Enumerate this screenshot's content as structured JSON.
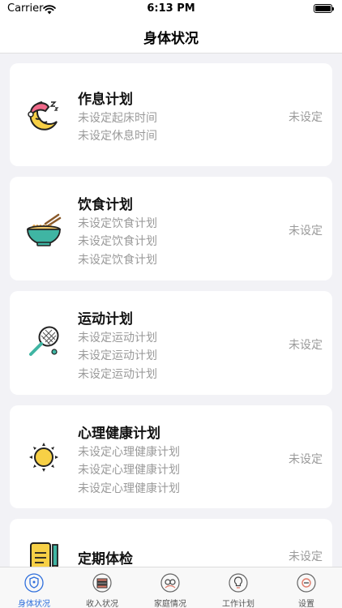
{
  "status_bar": {
    "carrier": "Carrier",
    "time": "6:13 PM"
  },
  "nav": {
    "title": "身体状况"
  },
  "colors": {
    "accent": "#2f6fdc",
    "background": "#f2f2f6",
    "card": "#ffffff",
    "muted_text": "#9a9a9a"
  },
  "cards": [
    {
      "icon": "sleeping-moon-icon",
      "title": "作息计划",
      "lines": [
        "未设定起床时间",
        "未设定休息时间"
      ],
      "status": "未设定"
    },
    {
      "icon": "noodle-bowl-icon",
      "title": "饮食计划",
      "lines": [
        "未设定饮食计划",
        "未设定饮食计划",
        "未设定饮食计划"
      ],
      "status": "未设定"
    },
    {
      "icon": "tennis-racket-icon",
      "title": "运动计划",
      "lines": [
        "未设定运动计划",
        "未设定运动计划",
        "未设定运动计划"
      ],
      "status": "未设定"
    },
    {
      "icon": "sun-icon",
      "title": "心理健康计划",
      "lines": [
        "未设定心理健康计划",
        "未设定心理健康计划",
        "未设定心理健康计划"
      ],
      "status": "未设定"
    },
    {
      "icon": "clipboard-pencil-icon",
      "title": "定期体检",
      "lines": [],
      "status": "未设定"
    }
  ],
  "tabs": [
    {
      "label": "身体状况",
      "icon": "shield-heart-icon",
      "active": true
    },
    {
      "label": "收入状况",
      "icon": "money-stack-icon",
      "active": false
    },
    {
      "label": "家庭情况",
      "icon": "family-icon",
      "active": false
    },
    {
      "label": "工作计划",
      "icon": "lightbulb-icon",
      "active": false
    },
    {
      "label": "设置",
      "icon": "settings-circle-icon",
      "active": false
    }
  ]
}
